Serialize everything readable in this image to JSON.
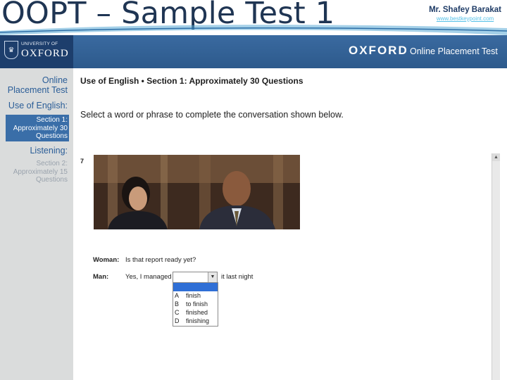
{
  "slide": {
    "title": "OOPT – Sample Test 1",
    "author": "Mr. Shafey Barakat",
    "author_link": "www.bestkeypoint.com"
  },
  "header": {
    "university_small": "UNIVERSITY OF",
    "university_big": "OXFORD",
    "brand": "OXFORD",
    "product": "Online Placement Test"
  },
  "sidebar": {
    "title_line1": "Online",
    "title_line2": "Placement Test",
    "use_of_english": "Use of English:",
    "section1_line1": "Section 1:",
    "section1_line2": "Approximately 30",
    "section1_line3": "Questions",
    "listening": "Listening:",
    "section2_line1": "Section 2:",
    "section2_line2": "Approximately 15",
    "section2_line3": "Questions"
  },
  "main": {
    "section_heading": "Use of English • Section 1: Approximately 30 Questions",
    "instruction": "Select a word or phrase to complete the conversation shown below.",
    "question_number": "7",
    "woman_label": "Woman:",
    "woman_line": "Is that report ready yet?",
    "man_label": "Man:",
    "man_line_before": "Yes, I managed",
    "man_line_after": "it last night",
    "options": [
      {
        "letter": "A",
        "text": "finish"
      },
      {
        "letter": "B",
        "text": "to finish"
      },
      {
        "letter": "C",
        "text": "finished"
      },
      {
        "letter": "D",
        "text": "finishing"
      }
    ]
  },
  "colors": {
    "title": "#1f3553",
    "header_bar": "#2d5a8c",
    "sidebar_bg": "#dadcdc",
    "sidebar_active": "#3a6ea8",
    "listbox_highlight": "#2f6fd6"
  },
  "icons": [
    "oxford-crest-icon",
    "dropdown-arrow-icon",
    "scroll-up-icon"
  ]
}
